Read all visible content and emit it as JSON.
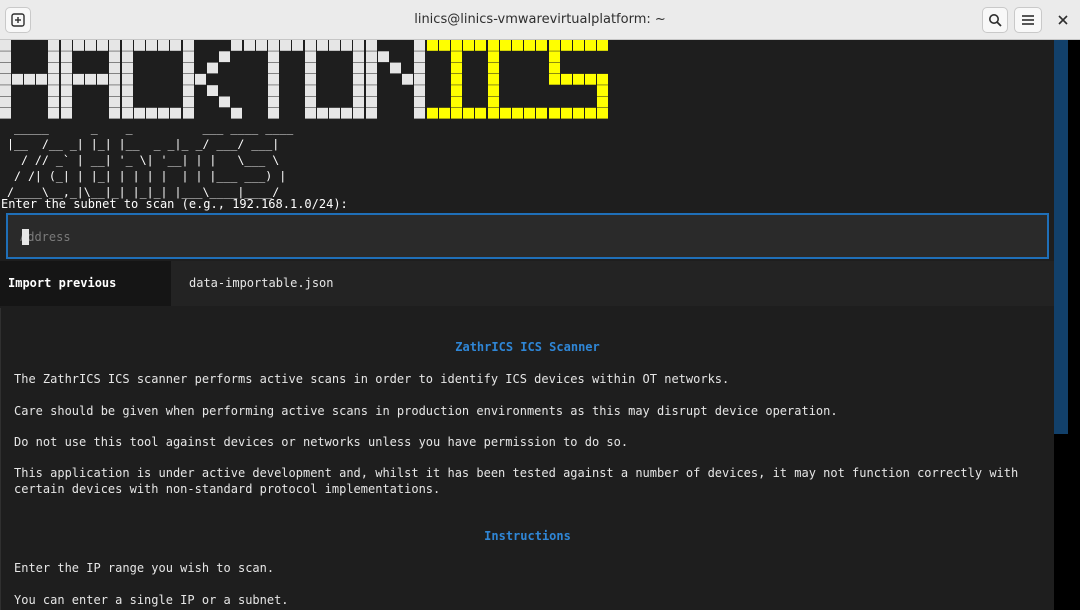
{
  "window": {
    "title": "linics@linics-vmwarevirtualplatform: ~",
    "icons": {
      "new_tab": "new-tab-icon",
      "search": "search-icon",
      "menu": "hamburger-menu-icon",
      "close": "close-icon"
    }
  },
  "logo": {
    "part1": "HACKTON",
    "part2": "ICS",
    "colors": {
      "part1": "#e6e6e6",
      "part2": "#ffff00"
    }
  },
  "ascii_banner": " _____      _    _          ___ ____ ____\n|__  /__ _| |_| |__  _ _|_ _/ ___/ ___|\n  / // _` | __| '_ \\| '__| | |   \\___ \\\n / /| (_| | |_| | | | |  | | |___ ___) |\n/____\\__,_|\\__|_| |_|_| |___\\____|____/",
  "prompt": "Enter the subnet to scan (e.g., 192.168.1.0/24):",
  "address": {
    "placeholder": "Address",
    "value": ""
  },
  "import": {
    "button_label": "Import previous session",
    "file": "data-importable.json"
  },
  "info": {
    "heading": "ZathrICS ICS Scanner",
    "paragraphs": [
      "The ZathrICS ICS scanner performs active scans in order to identify ICS devices within OT networks.",
      "Care should be given when performing active scans in production environments as this may disrupt device operation.",
      "Do not use this tool against devices or networks unless you have permission to do so.",
      "This application is under active development and, whilst it has been tested against a number of devices, it may not function correctly with certain devices with non-standard protocol implementations."
    ],
    "instructions_heading": "Instructions",
    "instructions": [
      "Enter the IP range you wish to scan.",
      "You can enter a single IP or a subnet."
    ]
  },
  "colors": {
    "accent": "#1f6fb8",
    "heading": "#2f86d6",
    "background": "#1e1e1e"
  }
}
